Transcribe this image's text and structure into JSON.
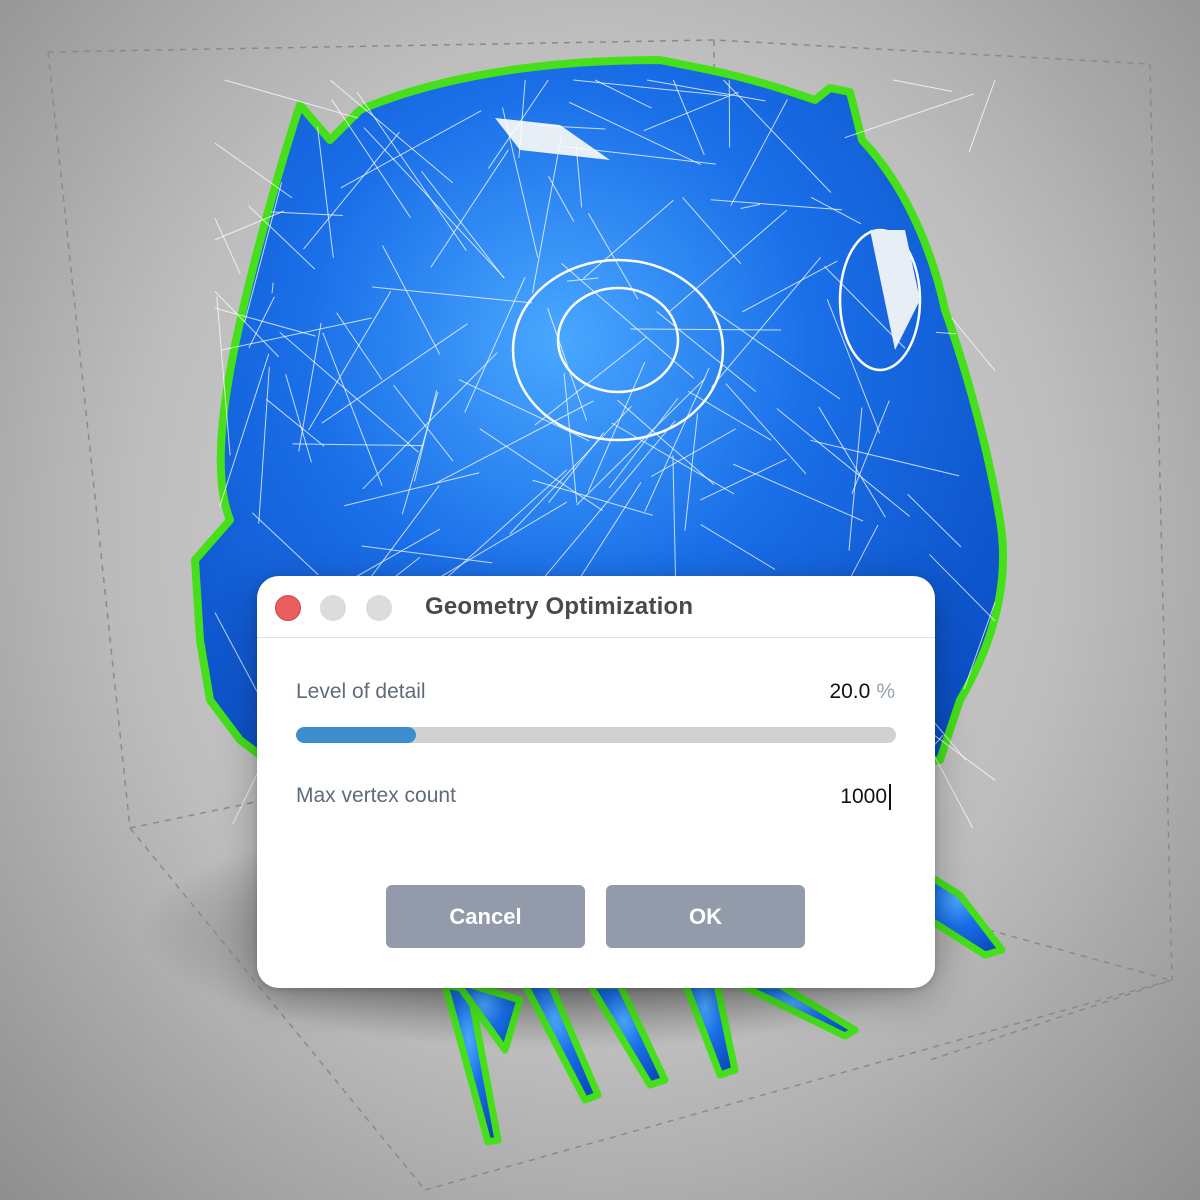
{
  "dialog": {
    "title": "Geometry Optimization",
    "window_controls": [
      "close",
      "minimize",
      "zoom"
    ],
    "level_of_detail": {
      "label": "Level of detail",
      "value": "20.0",
      "unit": "%",
      "fraction": 0.2
    },
    "max_vertex_count": {
      "label": "Max vertex count",
      "value": "1000"
    },
    "buttons": {
      "cancel": "Cancel",
      "ok": "OK"
    }
  },
  "viewport": {
    "model_color": "#1a6fe8",
    "outline_color": "#45e01a",
    "wire_color": "#ffffff"
  }
}
